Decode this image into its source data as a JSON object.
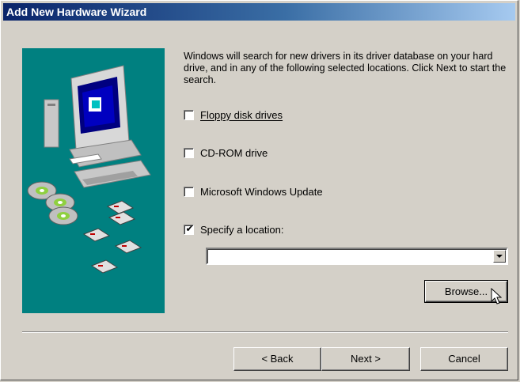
{
  "window": {
    "title": "Add New Hardware Wizard"
  },
  "description": "Windows will search for new drivers in its driver database on your hard drive, and in any of the following selected locations. Click Next to start the search.",
  "options": [
    {
      "label": "Floppy disk drives",
      "checked": false
    },
    {
      "label": "CD-ROM drive",
      "checked": false
    },
    {
      "label": "Microsoft Windows Update",
      "checked": false
    },
    {
      "label": "Specify a location:",
      "checked": true
    }
  ],
  "location": {
    "value": ""
  },
  "buttons": {
    "browse": "Browse...",
    "back": "< Back",
    "next": "Next >",
    "cancel": "Cancel"
  },
  "check_glyph": "✔"
}
